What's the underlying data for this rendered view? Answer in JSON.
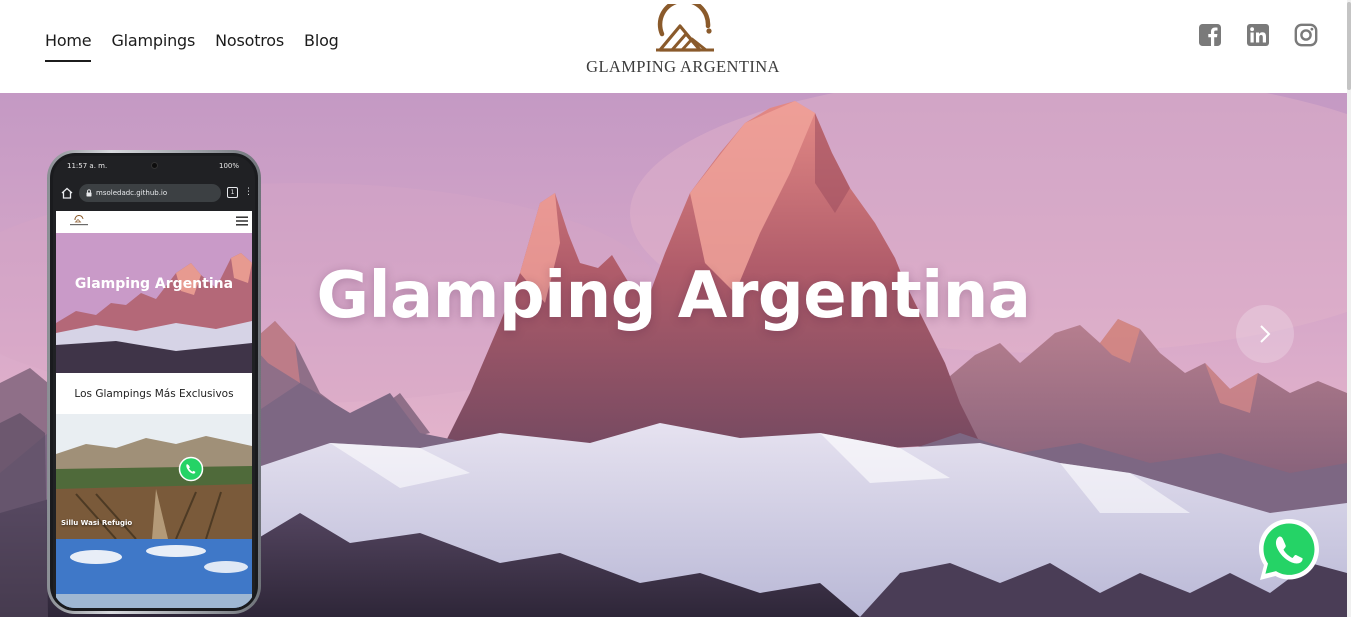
{
  "nav": {
    "items": [
      {
        "label": "Home",
        "active": true
      },
      {
        "label": "Glampings",
        "active": false
      },
      {
        "label": "Nosotros",
        "active": false
      },
      {
        "label": "Blog",
        "active": false
      }
    ]
  },
  "brand": {
    "name": "GLAMPING ARGENTINA",
    "logo_color": "#8a5a2b"
  },
  "social": [
    {
      "name": "facebook-icon"
    },
    {
      "name": "linkedin-icon"
    },
    {
      "name": "instagram-icon"
    }
  ],
  "hero": {
    "title": "Glamping Argentina",
    "next_icon": "chevron-right-icon"
  },
  "whatsapp": {
    "icon": "whatsapp-icon",
    "color": "#25d366"
  },
  "phone_mockup": {
    "status_time": "11:57 a. m.",
    "status_battery": "100%",
    "url": "msoledadc.github.io",
    "tab_count": "1",
    "mini_hero_title": "Glamping Argentina",
    "mini_caption": "Los Glampings Más Exclusivos",
    "card_label": "Sillu Wasi Refugio"
  },
  "colors": {
    "text_dark": "#1c1c1c",
    "icon_gray": "#7a7a7a",
    "sky_top": "#c8a0c8",
    "peak_rose": "#d87070"
  }
}
